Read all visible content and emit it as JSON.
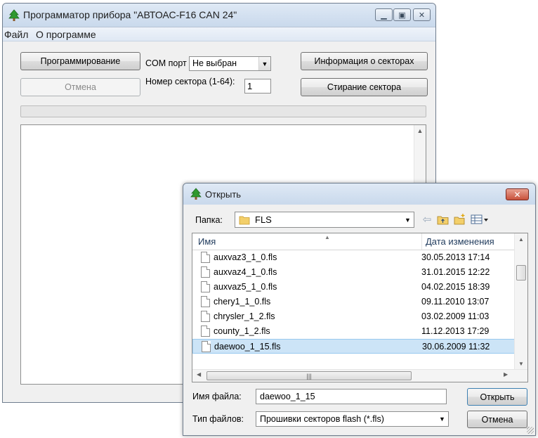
{
  "main_window": {
    "title": "Программатор прибора \"АВТОАС-F16 CAN 24\"",
    "menu": [
      "Файл",
      "О программе"
    ],
    "program_button": "Программирование",
    "cancel_button": "Отмена",
    "com_port_label": "COM порт",
    "com_port_value": "Не выбран",
    "sector_label": "Номер сектора (1-64):",
    "sector_value": "1",
    "sector_info_button": "Информация о секторах",
    "erase_sector_button": "Стирание сектора"
  },
  "open_dialog": {
    "title": "Открыть",
    "folder_label": "Папка:",
    "folder_value": "FLS",
    "columns": {
      "name": "Имя",
      "date": "Дата изменения"
    },
    "files": [
      {
        "name": "auxvaz3_1_0.fls",
        "date": "30.05.2013 17:14"
      },
      {
        "name": "auxvaz4_1_0.fls",
        "date": "31.01.2015 12:22"
      },
      {
        "name": "auxvaz5_1_0.fls",
        "date": "04.02.2015 18:39"
      },
      {
        "name": "chery1_1_0.fls",
        "date": "09.11.2010 13:07"
      },
      {
        "name": "chrysler_1_2.fls",
        "date": "03.02.2009 11:03"
      },
      {
        "name": "county_1_2.fls",
        "date": "11.12.2013 17:29"
      },
      {
        "name": "daewoo_1_15.fls",
        "date": "30.06.2009 11:32"
      }
    ],
    "selected_file_index": 6,
    "filename_label": "Имя файла:",
    "filename_value": "daewoo_1_15",
    "filetype_label": "Тип файлов:",
    "filetype_value": "Прошивки секторов flash (*.fls)",
    "open_button": "Открыть",
    "cancel_button": "Отмена"
  },
  "colors": {
    "title_bar": "#c9d9ec",
    "selection": "#cce4f7",
    "close_button": "#c8523c",
    "window_bg": "#f0f0f0"
  },
  "icons": {
    "app": "green-tree-icon",
    "folder": "folder-icon",
    "back": "back-arrow-icon",
    "up_folder": "up-folder-icon",
    "new_folder": "new-folder-icon",
    "view_menu": "view-menu-icon"
  }
}
